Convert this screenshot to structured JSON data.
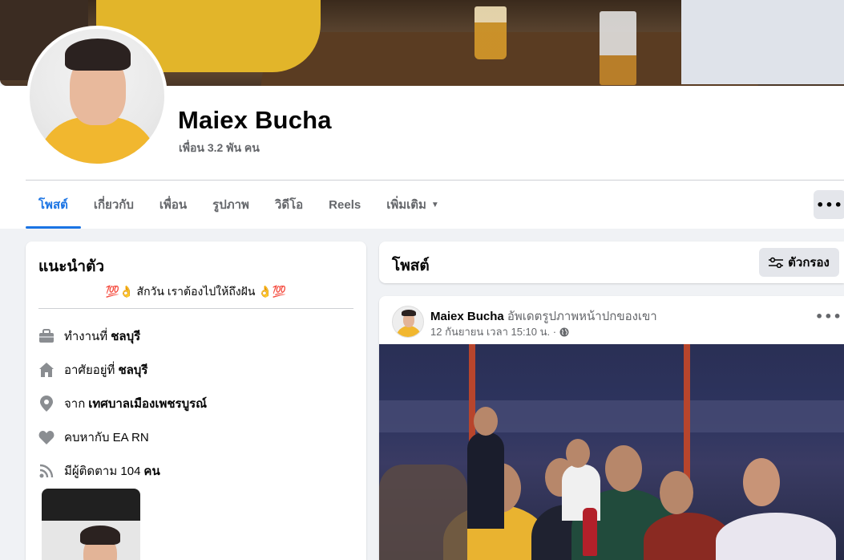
{
  "profile": {
    "name": "Maiex Bucha",
    "friends_count": "เพื่อน 3.2 พัน คน"
  },
  "tabs": [
    {
      "label": "โพสต์",
      "active": true
    },
    {
      "label": "เกี่ยวกับ",
      "active": false
    },
    {
      "label": "เพื่อน",
      "active": false
    },
    {
      "label": "รูปภาพ",
      "active": false
    },
    {
      "label": "วิดีโอ",
      "active": false
    },
    {
      "label": "Reels",
      "active": false
    },
    {
      "label": "เพิ่มเติม",
      "active": false
    }
  ],
  "more_button": "•••",
  "intro": {
    "title": "แนะนำตัว",
    "bio_text": "สักวัน เราต้องไปให้ถึงฝัน",
    "bio_emoji_left": "💯👌",
    "bio_emoji_right": "👌💯",
    "items": [
      {
        "icon": "briefcase-icon",
        "prefix": "ทำงานที่",
        "value": "ชลบุรี"
      },
      {
        "icon": "home-icon",
        "prefix": "อาศัยอยู่ที่",
        "value": "ชลบุรี"
      },
      {
        "icon": "location-pin-icon",
        "prefix": "จาก",
        "value": "เทศบาลเมืองเพชรบูรณ์"
      },
      {
        "icon": "heart-icon",
        "prefix": "คบหากับ EA RN",
        "value": ""
      },
      {
        "icon": "rss-icon",
        "prefix": "มีผู้ติดตาม 104",
        "value": "คน"
      }
    ]
  },
  "posts": {
    "title": "โพสต์",
    "filter_label": "ตัวกรอง"
  },
  "post": {
    "author": "Maiex Bucha",
    "action": "อัพเดตรูปภาพหน้าปกของเขา",
    "timestamp": "12 กันยายน เวลา 15:10 น. ·",
    "menu": "•••"
  },
  "colors": {
    "accent": "#1b74e4",
    "secondary_text": "#65676b",
    "background": "#f0f2f5"
  }
}
